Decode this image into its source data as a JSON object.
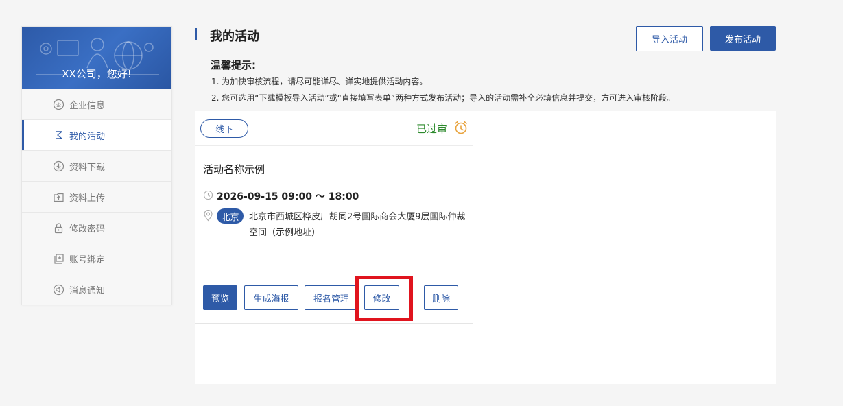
{
  "sidebar": {
    "greeting": "XX公司，您好!",
    "items": [
      {
        "label": "企业信息",
        "icon": "enterprise-icon"
      },
      {
        "label": "我的活动",
        "icon": "activity-icon",
        "active": true
      },
      {
        "label": "资料下载",
        "icon": "download-icon"
      },
      {
        "label": "资料上传",
        "icon": "upload-icon"
      },
      {
        "label": "修改密码",
        "icon": "lock-icon"
      },
      {
        "label": "账号绑定",
        "icon": "bind-icon"
      },
      {
        "label": "消息通知",
        "icon": "notification-icon"
      }
    ]
  },
  "header": {
    "title": "我的活动",
    "import_label": "导入活动",
    "publish_label": "发布活动"
  },
  "tips": {
    "title": "温馨提示:",
    "lines": [
      "1. 为加快审核流程，请尽可能详尽、详实地提供活动内容。",
      "2. 您可选用“下载模板导入活动”或“直接填写表单”两种方式发布活动；导入的活动需补全必填信息并提交，方可进入审核阶段。"
    ]
  },
  "card": {
    "type_tag": "线下",
    "status": "已过审",
    "name": "活动名称示例",
    "time": "2026-09-15 09:00 ～ 18:00",
    "city": "北京",
    "address": "北京市西城区桦皮厂胡同2号国际商会大厦9层国际仲裁空间（示例地址）",
    "buttons": {
      "preview": "预览",
      "poster": "生成海报",
      "signup": "报名管理",
      "edit": "修改",
      "delete": "删除"
    }
  },
  "colors": {
    "primary": "#2e5aa7",
    "approved": "#2d8a2d",
    "highlight": "#e0141e",
    "alarm": "#e8a33d"
  }
}
